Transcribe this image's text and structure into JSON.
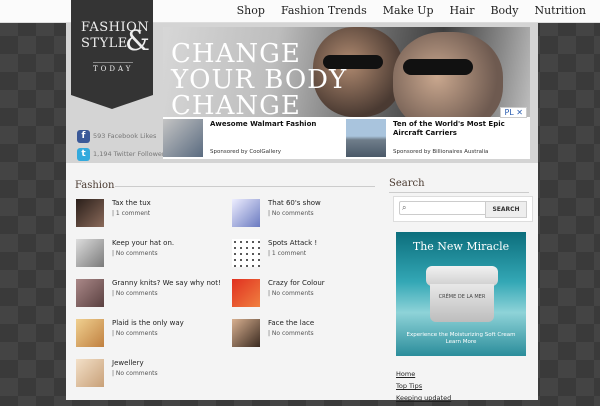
{
  "nav": [
    "Shop",
    "Fashion Trends",
    "Make Up",
    "Hair",
    "Body",
    "Nutrition"
  ],
  "logo": {
    "line1": "FASHION",
    "line2": "STYLE",
    "amp": "&",
    "line3": "TODAY"
  },
  "social": [
    {
      "icon": "facebook-icon",
      "label": "593 Facebook Likes",
      "color": "#3b5998",
      "glyph": "f"
    },
    {
      "icon": "twitter-icon",
      "label": "1,194 Twitter Followers",
      "color": "#33aadd",
      "glyph": "t"
    }
  ],
  "banner": {
    "headline": [
      "CHANGE",
      "YOUR BODY",
      "CHANGE"
    ]
  },
  "ads": [
    {
      "title": "Awesome Walmart Fashion",
      "sponsor": "Sponsored by CoolGallery"
    },
    {
      "title": "Ten of the World's Most Epic Aircraft Carriers",
      "sponsor": "Sponsored by Billionaires Australia"
    }
  ],
  "ad_badge": "PL",
  "fashion": {
    "title": "Fashion",
    "posts_left": [
      {
        "title": "Tax the tux",
        "meta": "| 1 comment"
      },
      {
        "title": "Keep your hat on.",
        "meta": "| No comments"
      },
      {
        "title": "Granny knits? We say why not!",
        "meta": "| No comments"
      },
      {
        "title": "Plaid is the only way",
        "meta": "| No comments"
      },
      {
        "title": "Jewellery",
        "meta": "| No comments"
      }
    ],
    "posts_right": [
      {
        "title": "That 60's show",
        "meta": "| No comments"
      },
      {
        "title": "Spots Attack !",
        "meta": "| 1 comment"
      },
      {
        "title": "Crazy for Colour",
        "meta": "| No comments"
      },
      {
        "title": "Face the lace",
        "meta": "| No comments"
      }
    ]
  },
  "search": {
    "title": "Search",
    "placeholder": "",
    "button": "SEARCH"
  },
  "cream_ad": {
    "title": "The New Miracle",
    "brand": "CRÈME DE LA MER",
    "caption_1": "Experience the Moisturizing Soft Cream",
    "caption_2": "Learn More"
  },
  "links": [
    "Home",
    "Top Tips",
    "Keeping updated"
  ]
}
